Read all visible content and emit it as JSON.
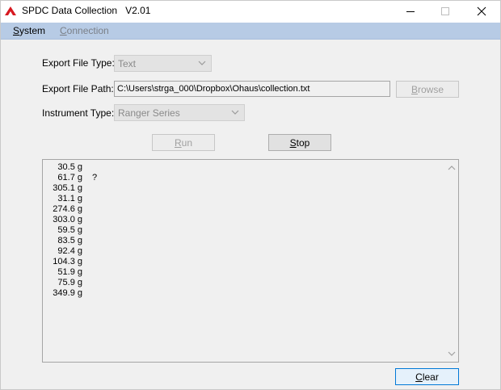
{
  "window": {
    "title": "SPDC Data Collection",
    "version": "V2.01"
  },
  "menu": {
    "system": {
      "underline": "S",
      "rest": "ystem"
    },
    "connection": {
      "underline": "C",
      "rest": "onnection"
    }
  },
  "form": {
    "export_file_type_label": "Export File Type:",
    "export_file_type_value": "Text",
    "export_file_path_label": "Export File Path:",
    "export_file_path_value": "C:\\Users\\strga_000\\Dropbox\\Ohaus\\collection.txt",
    "browse": {
      "underline": "B",
      "rest": "rowse"
    },
    "instrument_type_label": "Instrument Type:",
    "instrument_type_value": "Ranger Series"
  },
  "actions": {
    "run": {
      "underline": "R",
      "rest": "un"
    },
    "stop": {
      "underline": "S",
      "rest": "top"
    },
    "clear": {
      "underline": "C",
      "rest": "lear"
    }
  },
  "output": {
    "lines": [
      {
        "value": "30.5 g",
        "flag": ""
      },
      {
        "value": "61.7 g",
        "flag": "?"
      },
      {
        "value": "305.1 g",
        "flag": ""
      },
      {
        "value": "31.1 g",
        "flag": ""
      },
      {
        "value": "274.6 g",
        "flag": ""
      },
      {
        "value": "303.0 g",
        "flag": ""
      },
      {
        "value": "59.5 g",
        "flag": ""
      },
      {
        "value": "83.5 g",
        "flag": ""
      },
      {
        "value": "92.4 g",
        "flag": ""
      },
      {
        "value": "104.3 g",
        "flag": ""
      },
      {
        "value": "51.9 g",
        "flag": ""
      },
      {
        "value": "75.9 g",
        "flag": ""
      },
      {
        "value": "349.9 g",
        "flag": ""
      }
    ]
  },
  "colors": {
    "menubar": "#b7cbe5",
    "window_bg": "#f0f0f0",
    "focus_border": "#0078d7",
    "logo_red": "#d71920"
  }
}
